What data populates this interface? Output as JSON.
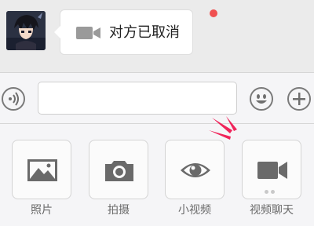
{
  "chat": {
    "message_text": "对方已取消",
    "message_icon": "video-camera-icon"
  },
  "input_bar": {
    "voice_icon": "voice-icon",
    "emoji_icon": "emoji-icon",
    "plus_icon": "plus-icon",
    "input_value": ""
  },
  "panel": {
    "tools": [
      {
        "label": "照片",
        "icon": "photo-icon"
      },
      {
        "label": "拍摄",
        "icon": "camera-icon"
      },
      {
        "label": "小视频",
        "icon": "eye-icon"
      },
      {
        "label": "视频聊天",
        "icon": "video-camera-icon"
      }
    ]
  },
  "colors": {
    "accent_red": "#f0245a",
    "unread_dot": "#f05050",
    "icon_gray": "#6a6a6a"
  }
}
